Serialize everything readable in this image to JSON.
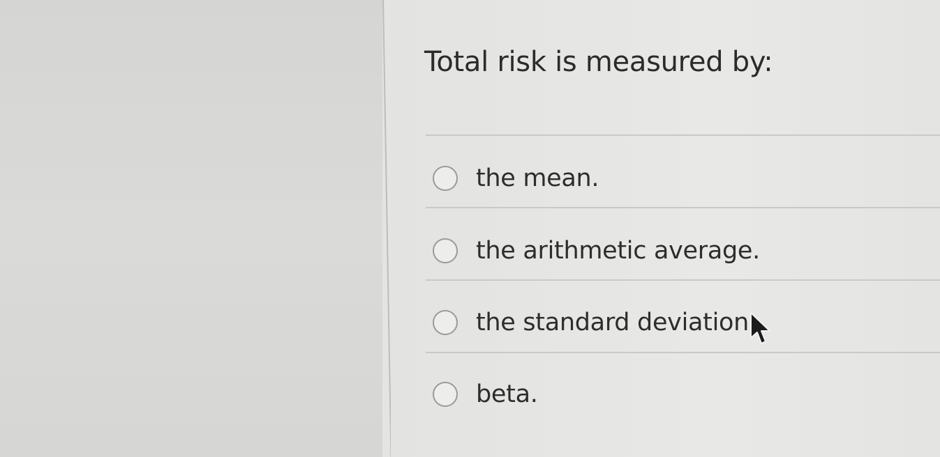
{
  "question": {
    "text": "Total risk is measured by:"
  },
  "options": [
    {
      "label": "the mean."
    },
    {
      "label": "the arithmetic average."
    },
    {
      "label": "the standard deviation"
    },
    {
      "label": "beta."
    }
  ],
  "icons": {
    "radio": "radio-unselected-icon",
    "cursor": "mouse-pointer-icon"
  },
  "colors": {
    "text": "#2b2b2b",
    "radio_border": "#9a9a98",
    "background": "#e6e6e4",
    "rule": "#c9c9c7"
  }
}
